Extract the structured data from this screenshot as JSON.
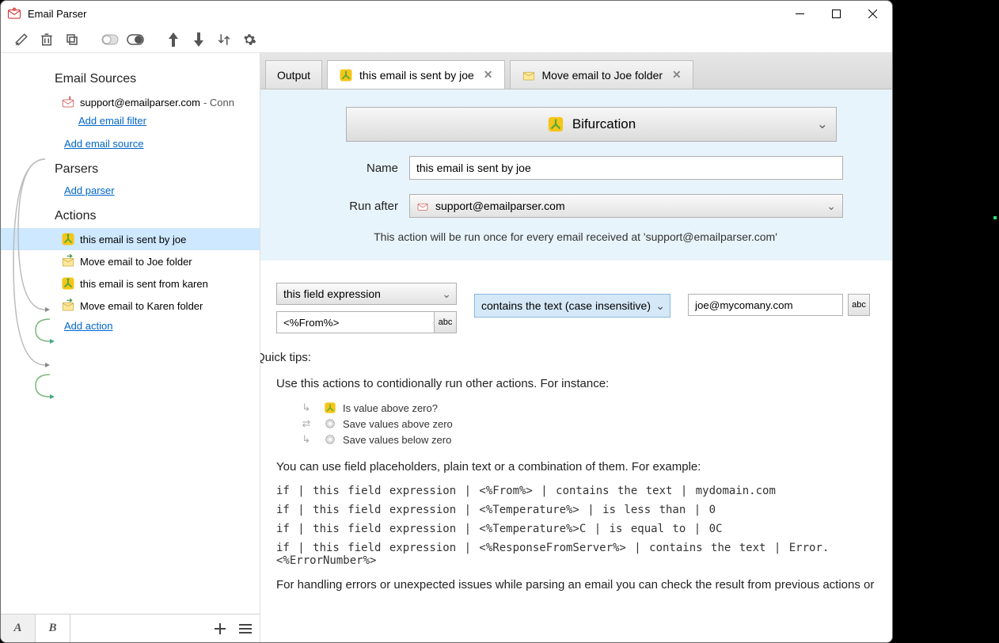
{
  "window": {
    "title": "Email Parser"
  },
  "tabs": [
    {
      "label": "Output",
      "closable": false,
      "icon": null,
      "active": false
    },
    {
      "label": "this email is sent by joe",
      "closable": true,
      "icon": "bifurcation",
      "active": true
    },
    {
      "label": "Move email to Joe folder",
      "closable": true,
      "icon": "move-folder",
      "active": false
    }
  ],
  "sidebar": {
    "sections": {
      "email_sources": {
        "heading": "Email Sources",
        "source": {
          "label": "support@emailparser.com",
          "status": "- Conn"
        },
        "add_filter": "Add email filter",
        "add_source": "Add email source"
      },
      "parsers": {
        "heading": "Parsers",
        "add_parser": "Add parser"
      },
      "actions": {
        "heading": "Actions",
        "items": [
          {
            "label": "this email is sent by joe",
            "icon": "bifurcation",
            "selected": true
          },
          {
            "label": "Move email to Joe folder",
            "icon": "move-folder",
            "selected": false
          },
          {
            "label": "this email is sent from karen",
            "icon": "bifurcation",
            "selected": false
          },
          {
            "label": "Move email to Karen folder",
            "icon": "move-folder",
            "selected": false
          }
        ],
        "add_action": "Add action"
      }
    }
  },
  "bottom_tabs": {
    "a": "A",
    "b": "B"
  },
  "form": {
    "type_button": "Bifurcation",
    "name_label": "Name",
    "name_value": "this email is sent by joe",
    "run_after_label": "Run after",
    "run_after_value": "support@emailparser.com",
    "note": "This action will be run once for every email received at 'support@emailparser.com'"
  },
  "condition": {
    "field_mode": "this field expression",
    "field_value": "<%From%>",
    "operator": "contains the text (case insensitive)",
    "compare_value": "joe@mycomany.com",
    "abc": "abc"
  },
  "tips": {
    "heading": "Quick tips:",
    "p1": "Use this actions to contidionally run other actions. For instance:",
    "example": [
      "Is value above zero?",
      "Save values above zero",
      "Save values below zero"
    ],
    "p2": "You can use field placeholders, plain text or a combination of them. For example:",
    "code": [
      "if | this field expression | <%From%> | contains the text | mydomain.com",
      "if | this field expression | <%Temperature%> | is less than | 0",
      "if | this field expression | <%Temperature%>C | is equal to | 0C",
      "if | this field expression | <%ResponseFromServer%> | contains the text | Error. <%ErrorNumber%>"
    ],
    "p3": "For handling errors or unexpected issues while parsing an email you can check the result from previous actions or"
  }
}
